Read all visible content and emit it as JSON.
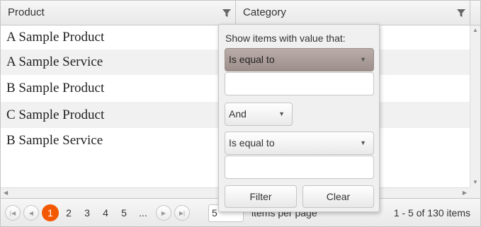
{
  "grid": {
    "columns": [
      {
        "title": "Product"
      },
      {
        "title": "Category"
      }
    ],
    "rows": [
      {
        "product": "A Sample Product",
        "category": ""
      },
      {
        "product": "A Sample Service",
        "category": ""
      },
      {
        "product": "B Sample Product",
        "category": ""
      },
      {
        "product": "C Sample Product",
        "category": ""
      },
      {
        "product": "B Sample Service",
        "category": ""
      }
    ]
  },
  "filter_menu": {
    "info": "Show items with value that:",
    "operator1": "Is equal to",
    "value1": "",
    "logic": "And",
    "operator2": "Is equal to",
    "value2": "",
    "filter_label": "Filter",
    "clear_label": "Clear"
  },
  "pager": {
    "pages": [
      "1",
      "2",
      "3",
      "4",
      "5",
      "..."
    ],
    "current_page": "1",
    "page_size": "5",
    "items_per_page_label": "items per page",
    "info": "1 - 5 of 130 items"
  },
  "colors": {
    "accent": "#f35800",
    "active_dropdown": "#a59894"
  },
  "icons": [
    "filter-icon",
    "first-page-icon",
    "previous-page-icon",
    "next-page-icon",
    "last-page-icon",
    "caret-down-icon",
    "scroll-arrow-icon"
  ]
}
